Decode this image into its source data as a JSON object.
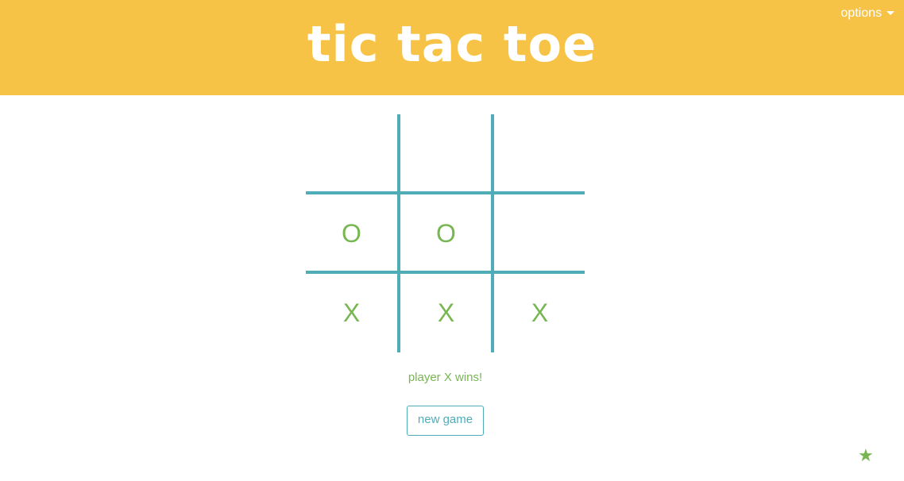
{
  "header": {
    "title": "tic tac toe",
    "options_label": "options"
  },
  "board": {
    "cells": [
      [
        "",
        "",
        ""
      ],
      [
        "O",
        "O",
        ""
      ],
      [
        "X",
        "X",
        "X"
      ]
    ]
  },
  "status": {
    "message": "player X wins!"
  },
  "controls": {
    "new_game_label": "new game"
  },
  "footer": {
    "star_icon": "star-icon",
    "star_glyph": "★"
  },
  "colors": {
    "header_bg": "#f7c346",
    "grid_lines": "#4fadb8",
    "marks": "#78b652"
  }
}
